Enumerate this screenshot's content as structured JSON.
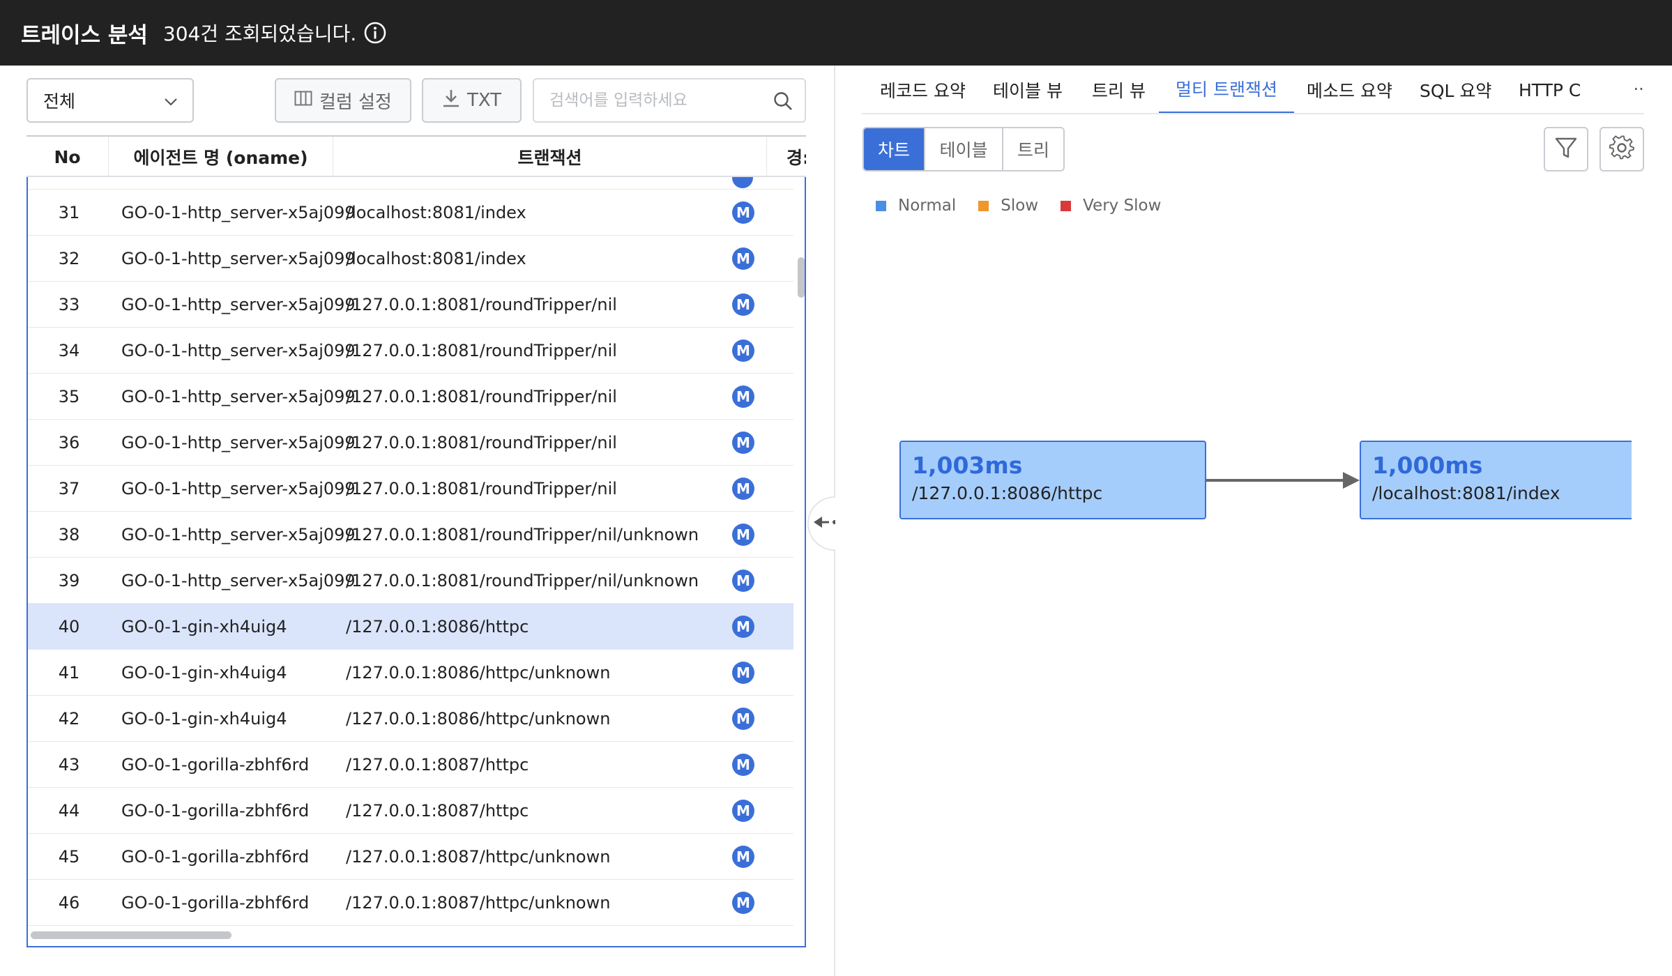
{
  "header": {
    "title": "트레이스 분석",
    "count_text": "304건 조회되었습니다."
  },
  "toolbar": {
    "filter_select": "전체",
    "column_settings": "컬럼 설정",
    "export_txt": "TXT",
    "search_placeholder": "검색어를 입력하세요"
  },
  "table": {
    "columns": [
      "No",
      "에이전트 명 (oname)",
      "트랜잭션",
      "경:"
    ],
    "rows": [
      {
        "no": "31",
        "agent": "GO-0-1-http_server-x5aj099",
        "tx": "/localhost:8081/index",
        "badge": "M"
      },
      {
        "no": "32",
        "agent": "GO-0-1-http_server-x5aj099",
        "tx": "/localhost:8081/index",
        "badge": "M"
      },
      {
        "no": "33",
        "agent": "GO-0-1-http_server-x5aj099",
        "tx": "/127.0.0.1:8081/roundTripper/nil",
        "badge": "M"
      },
      {
        "no": "34",
        "agent": "GO-0-1-http_server-x5aj099",
        "tx": "/127.0.0.1:8081/roundTripper/nil",
        "badge": "M"
      },
      {
        "no": "35",
        "agent": "GO-0-1-http_server-x5aj099",
        "tx": "/127.0.0.1:8081/roundTripper/nil",
        "badge": "M"
      },
      {
        "no": "36",
        "agent": "GO-0-1-http_server-x5aj099",
        "tx": "/127.0.0.1:8081/roundTripper/nil",
        "badge": "M"
      },
      {
        "no": "37",
        "agent": "GO-0-1-http_server-x5aj099",
        "tx": "/127.0.0.1:8081/roundTripper/nil",
        "badge": "M"
      },
      {
        "no": "38",
        "agent": "GO-0-1-http_server-x5aj099",
        "tx": "/127.0.0.1:8081/roundTripper/nil/unknown",
        "badge": "M"
      },
      {
        "no": "39",
        "agent": "GO-0-1-http_server-x5aj099",
        "tx": "/127.0.0.1:8081/roundTripper/nil/unknown",
        "badge": "M"
      },
      {
        "no": "40",
        "agent": "GO-0-1-gin-xh4uig4",
        "tx": "/127.0.0.1:8086/httpc",
        "badge": "M",
        "selected": true
      },
      {
        "no": "41",
        "agent": "GO-0-1-gin-xh4uig4",
        "tx": "/127.0.0.1:8086/httpc/unknown",
        "badge": "M"
      },
      {
        "no": "42",
        "agent": "GO-0-1-gin-xh4uig4",
        "tx": "/127.0.0.1:8086/httpc/unknown",
        "badge": "M"
      },
      {
        "no": "43",
        "agent": "GO-0-1-gorilla-zbhf6rd",
        "tx": "/127.0.0.1:8087/httpc",
        "badge": "M"
      },
      {
        "no": "44",
        "agent": "GO-0-1-gorilla-zbhf6rd",
        "tx": "/127.0.0.1:8087/httpc",
        "badge": "M"
      },
      {
        "no": "45",
        "agent": "GO-0-1-gorilla-zbhf6rd",
        "tx": "/127.0.0.1:8087/httpc/unknown",
        "badge": "M"
      },
      {
        "no": "46",
        "agent": "GO-0-1-gorilla-zbhf6rd",
        "tx": "/127.0.0.1:8087/httpc/unknown",
        "badge": "M"
      }
    ]
  },
  "right": {
    "tabs": [
      {
        "label": "레코드 요약"
      },
      {
        "label": "테이블 뷰"
      },
      {
        "label": "트리 뷰"
      },
      {
        "label": "멀티 트랜잭션",
        "active": true
      },
      {
        "label": "메소드 요약"
      },
      {
        "label": "SQL 요약"
      },
      {
        "label": "HTTP Ca"
      }
    ],
    "more_label": "···",
    "view_modes": [
      {
        "label": "차트",
        "active": true
      },
      {
        "label": "테이블"
      },
      {
        "label": "트리"
      }
    ],
    "legend": [
      {
        "label": "Normal",
        "color": "#4a90e2"
      },
      {
        "label": "Slow",
        "color": "#f0962e"
      },
      {
        "label": "Very Slow",
        "color": "#d9393b"
      }
    ],
    "nodes": [
      {
        "duration": "1,003ms",
        "path": "/127.0.0.1:8086/httpc"
      },
      {
        "duration": "1,000ms",
        "path": "/localhost:8081/index"
      }
    ]
  },
  "colors": {
    "accent": "#3b6fd8",
    "header_bg": "#222222",
    "selected_row": "#dae4fb",
    "node_fill": "#a5cdfc"
  }
}
